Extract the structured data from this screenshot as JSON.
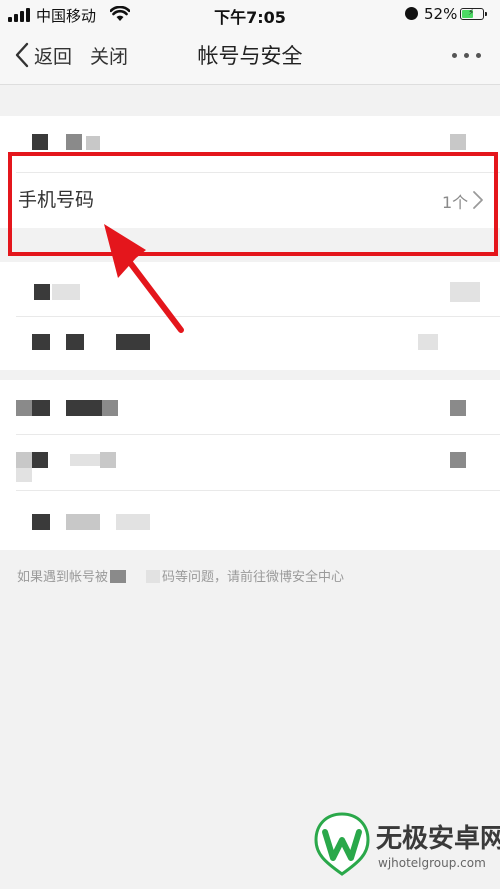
{
  "status_bar": {
    "carrier": "中国移动",
    "time": "下午7:05",
    "battery_percent": "52%",
    "icons": [
      "signal-icon",
      "wifi-icon",
      "alarm-icon",
      "battery-charging-icon"
    ]
  },
  "nav": {
    "back_label": "返回",
    "close_label": "关闭",
    "title": "帐号与安全",
    "more_icon": "more-icon"
  },
  "list": {
    "phone_row": {
      "label": "手机号码",
      "value": "1个",
      "icon": "chevron-right-icon"
    }
  },
  "footer": {
    "note_prefix": "如果遇到帐号被",
    "note_suffix": "码等问题，请前往微博安全中心"
  },
  "annotation": {
    "color": "#e4161c"
  },
  "watermark": {
    "brand": "无极安卓网",
    "url": "wjhotelgroup.com",
    "logo_color": "#2aa84a"
  }
}
